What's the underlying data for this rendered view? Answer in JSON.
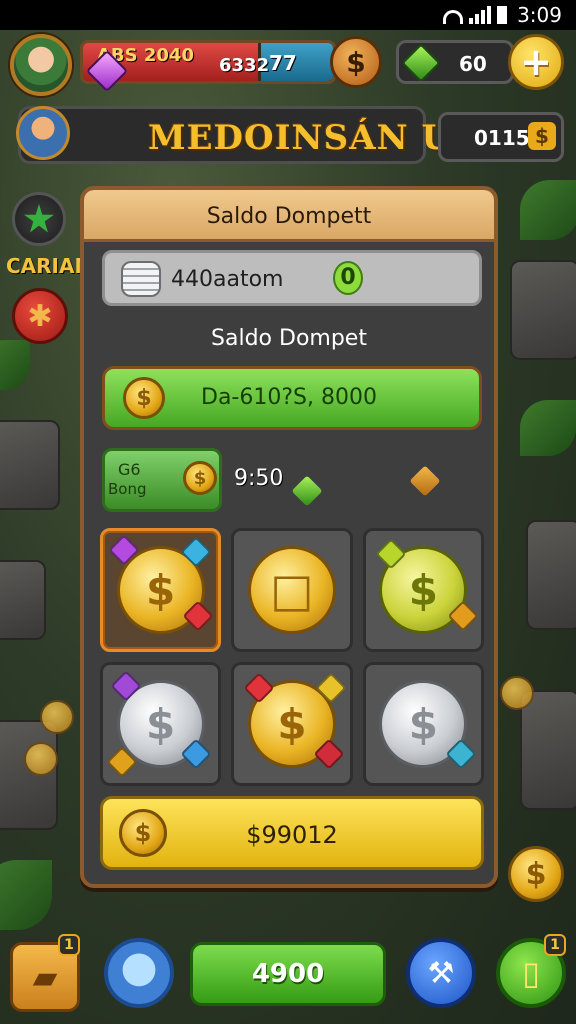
{
  "status_bar": {
    "time": "3:09"
  },
  "hud": {
    "player_name": "ABS 2040",
    "health_value": "6332",
    "energy_value": "77",
    "gems_value": "60",
    "currency_icon": "dollar-coin-icon"
  },
  "title_bar": {
    "title": "MEDOINSÁN UBI",
    "right_value": "0115"
  },
  "side": {
    "label": "CARIAN"
  },
  "wallet": {
    "header": "Saldo Dompett",
    "balance_label": "440aatom",
    "balance_count": "0",
    "section_title": "Saldo Dompet",
    "green_amount": "Da-610?S, 8000",
    "bonus_line1": "G6",
    "bonus_line2": "Bong",
    "timer": "9:50",
    "total": "$99012"
  },
  "coins": [
    {
      "kind": "gold",
      "symbol": "$",
      "selected": true
    },
    {
      "kind": "gold",
      "symbol": "□",
      "selected": false
    },
    {
      "kind": "lime",
      "symbol": "$",
      "selected": false
    },
    {
      "kind": "silver",
      "symbol": "$",
      "selected": false
    },
    {
      "kind": "gold",
      "symbol": "$",
      "selected": false
    },
    {
      "kind": "silver",
      "symbol": "$",
      "selected": false
    }
  ],
  "bottom_bar": {
    "center_value": "4900",
    "left_badge": "1",
    "right_badge": "1"
  },
  "colors": {
    "panel_border": "#8c5a2c",
    "green_button": "#46a823",
    "yellow_button": "#e2b30f",
    "title_gold": "#f5be2c"
  }
}
